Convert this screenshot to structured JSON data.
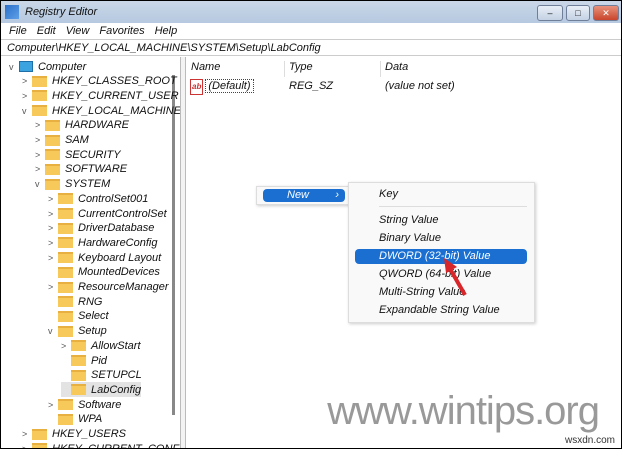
{
  "window": {
    "title": "Registry Editor",
    "minimize": "–",
    "maximize": "□",
    "close": "✕"
  },
  "menubar": [
    "File",
    "Edit",
    "View",
    "Favorites",
    "Help"
  ],
  "address": "Computer\\HKEY_LOCAL_MACHINE\\SYSTEM\\Setup\\LabConfig",
  "tree": [
    {
      "label": "Computer",
      "level": 0,
      "arrow": "v",
      "icon": "computer"
    },
    {
      "label": "HKEY_CLASSES_ROOT",
      "level": 1,
      "arrow": ">"
    },
    {
      "label": "HKEY_CURRENT_USER",
      "level": 1,
      "arrow": ">"
    },
    {
      "label": "HKEY_LOCAL_MACHINE",
      "level": 1,
      "arrow": "v"
    },
    {
      "label": "HARDWARE",
      "level": 2,
      "arrow": ">"
    },
    {
      "label": "SAM",
      "level": 2,
      "arrow": ">"
    },
    {
      "label": "SECURITY",
      "level": 2,
      "arrow": ">"
    },
    {
      "label": "SOFTWARE",
      "level": 2,
      "arrow": ">"
    },
    {
      "label": "SYSTEM",
      "level": 2,
      "arrow": "v"
    },
    {
      "label": "ControlSet001",
      "level": 3,
      "arrow": ">"
    },
    {
      "label": "CurrentControlSet",
      "level": 3,
      "arrow": ">"
    },
    {
      "label": "DriverDatabase",
      "level": 3,
      "arrow": ">"
    },
    {
      "label": "HardwareConfig",
      "level": 3,
      "arrow": ">"
    },
    {
      "label": "Keyboard Layout",
      "level": 3,
      "arrow": ">"
    },
    {
      "label": "MountedDevices",
      "level": 3,
      "arrow": ""
    },
    {
      "label": "ResourceManager",
      "level": 3,
      "arrow": ">"
    },
    {
      "label": "RNG",
      "level": 3,
      "arrow": ""
    },
    {
      "label": "Select",
      "level": 3,
      "arrow": ""
    },
    {
      "label": "Setup",
      "level": 3,
      "arrow": "v"
    },
    {
      "label": "AllowStart",
      "level": 4,
      "arrow": ">"
    },
    {
      "label": "Pid",
      "level": 4,
      "arrow": ""
    },
    {
      "label": "SETUPCL",
      "level": 4,
      "arrow": ""
    },
    {
      "label": "LabConfig",
      "level": 4,
      "arrow": "",
      "selected": true
    },
    {
      "label": "Software",
      "level": 3,
      "arrow": ">"
    },
    {
      "label": "WPA",
      "level": 3,
      "arrow": ""
    },
    {
      "label": "HKEY_USERS",
      "level": 1,
      "arrow": ">"
    },
    {
      "label": "HKEY_CURRENT_CONFIG",
      "level": 1,
      "arrow": ">"
    }
  ],
  "columns": {
    "name": "Name",
    "type": "Type",
    "data": "Data"
  },
  "values": [
    {
      "icon": "ab",
      "name": "(Default)",
      "type": "REG_SZ",
      "data": "(value not set)"
    }
  ],
  "context_menu": {
    "new": "New",
    "arrow": "›"
  },
  "submenu": [
    "Key",
    "String Value",
    "Binary Value",
    "DWORD (32-bit) Value",
    "QWORD (64-bit) Value",
    "Multi-String Value",
    "Expandable String Value"
  ],
  "submenu_highlighted": "DWORD (32-bit) Value",
  "watermark": "www.wintips.org",
  "watermark2": "wsxdn.com"
}
